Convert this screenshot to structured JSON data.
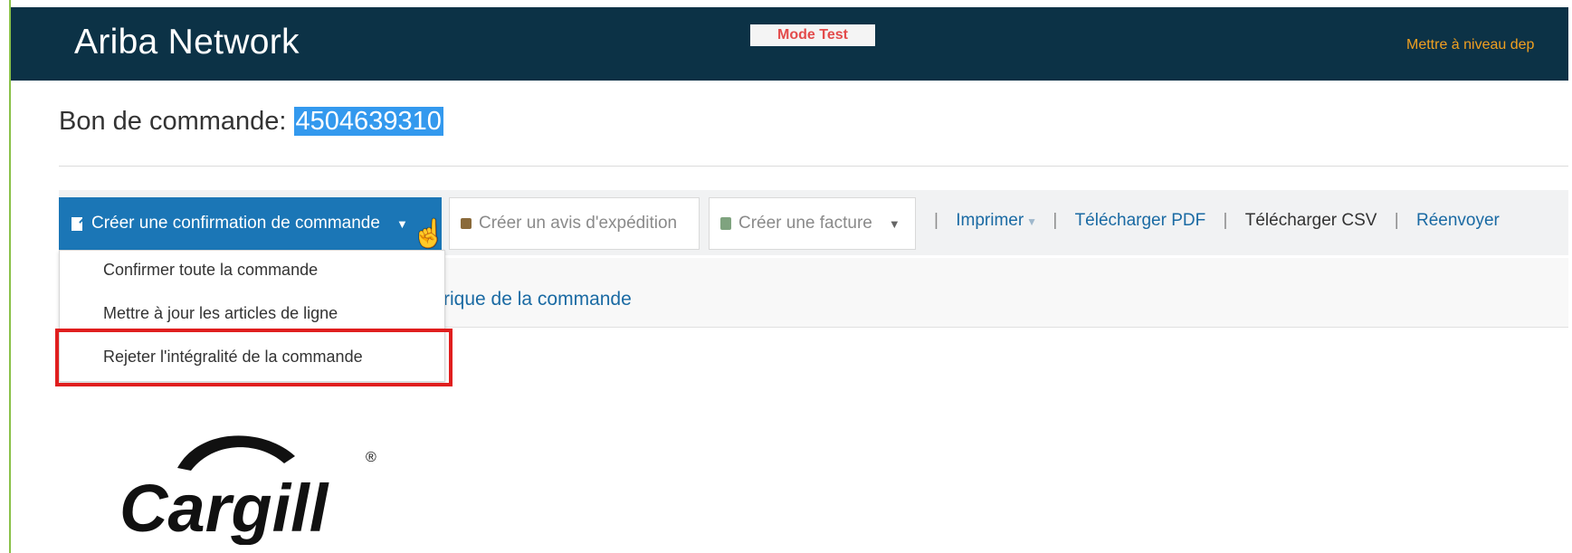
{
  "header": {
    "brand": "Ariba Network",
    "mode_badge": "Mode Test",
    "upgrade_link": "Mettre à niveau dep"
  },
  "page": {
    "title_label": "Bon de commande:",
    "po_number": "4504639310"
  },
  "toolbar": {
    "create_confirmation": "Créer une confirmation de commande",
    "create_ship_notice": "Créer un avis d'expédition",
    "create_invoice": "Créer une facture",
    "print": "Imprimer",
    "download_pdf": "Télécharger PDF",
    "download_csv": "Télécharger CSV",
    "resend": "Réenvoyer"
  },
  "dropdown": {
    "items": [
      "Confirmer toute la commande",
      "Mettre à jour les articles de ligne",
      "Rejeter l'intégralité de la commande"
    ]
  },
  "subnav": {
    "partial_text": "rique de la commande"
  },
  "logo": {
    "text": "Cargill",
    "mark": "®"
  },
  "colors": {
    "header_bg": "#0c3246",
    "primary_button": "#1b76b6",
    "link": "#1a6aa3",
    "upgrade_link": "#f0a020",
    "highlight_box": "#e01e1e",
    "mode_badge_text": "#e34b4b"
  },
  "icons": {
    "confirmation": "document-edit-icon",
    "ship_notice": "truck-icon",
    "invoice": "invoice-icon",
    "cursor": "hand-cursor-icon"
  }
}
